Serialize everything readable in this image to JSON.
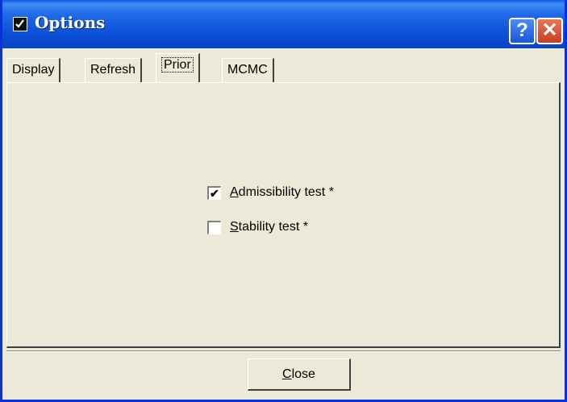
{
  "window": {
    "title": "Options",
    "help_label": "?",
    "close_label": "✕"
  },
  "tabs": [
    {
      "label": "Display",
      "active": false
    },
    {
      "label": "Refresh",
      "active": false
    },
    {
      "label": "Prior",
      "active": true
    },
    {
      "label": "MCMC",
      "active": false
    }
  ],
  "prior": {
    "admissibility": {
      "label_first": "A",
      "label_rest": "dmissibility test *",
      "checked": true
    },
    "stability": {
      "label_first": "S",
      "label_rest": "tability test *",
      "checked": false
    }
  },
  "footer": {
    "close_first": "C",
    "close_rest": "lose"
  }
}
